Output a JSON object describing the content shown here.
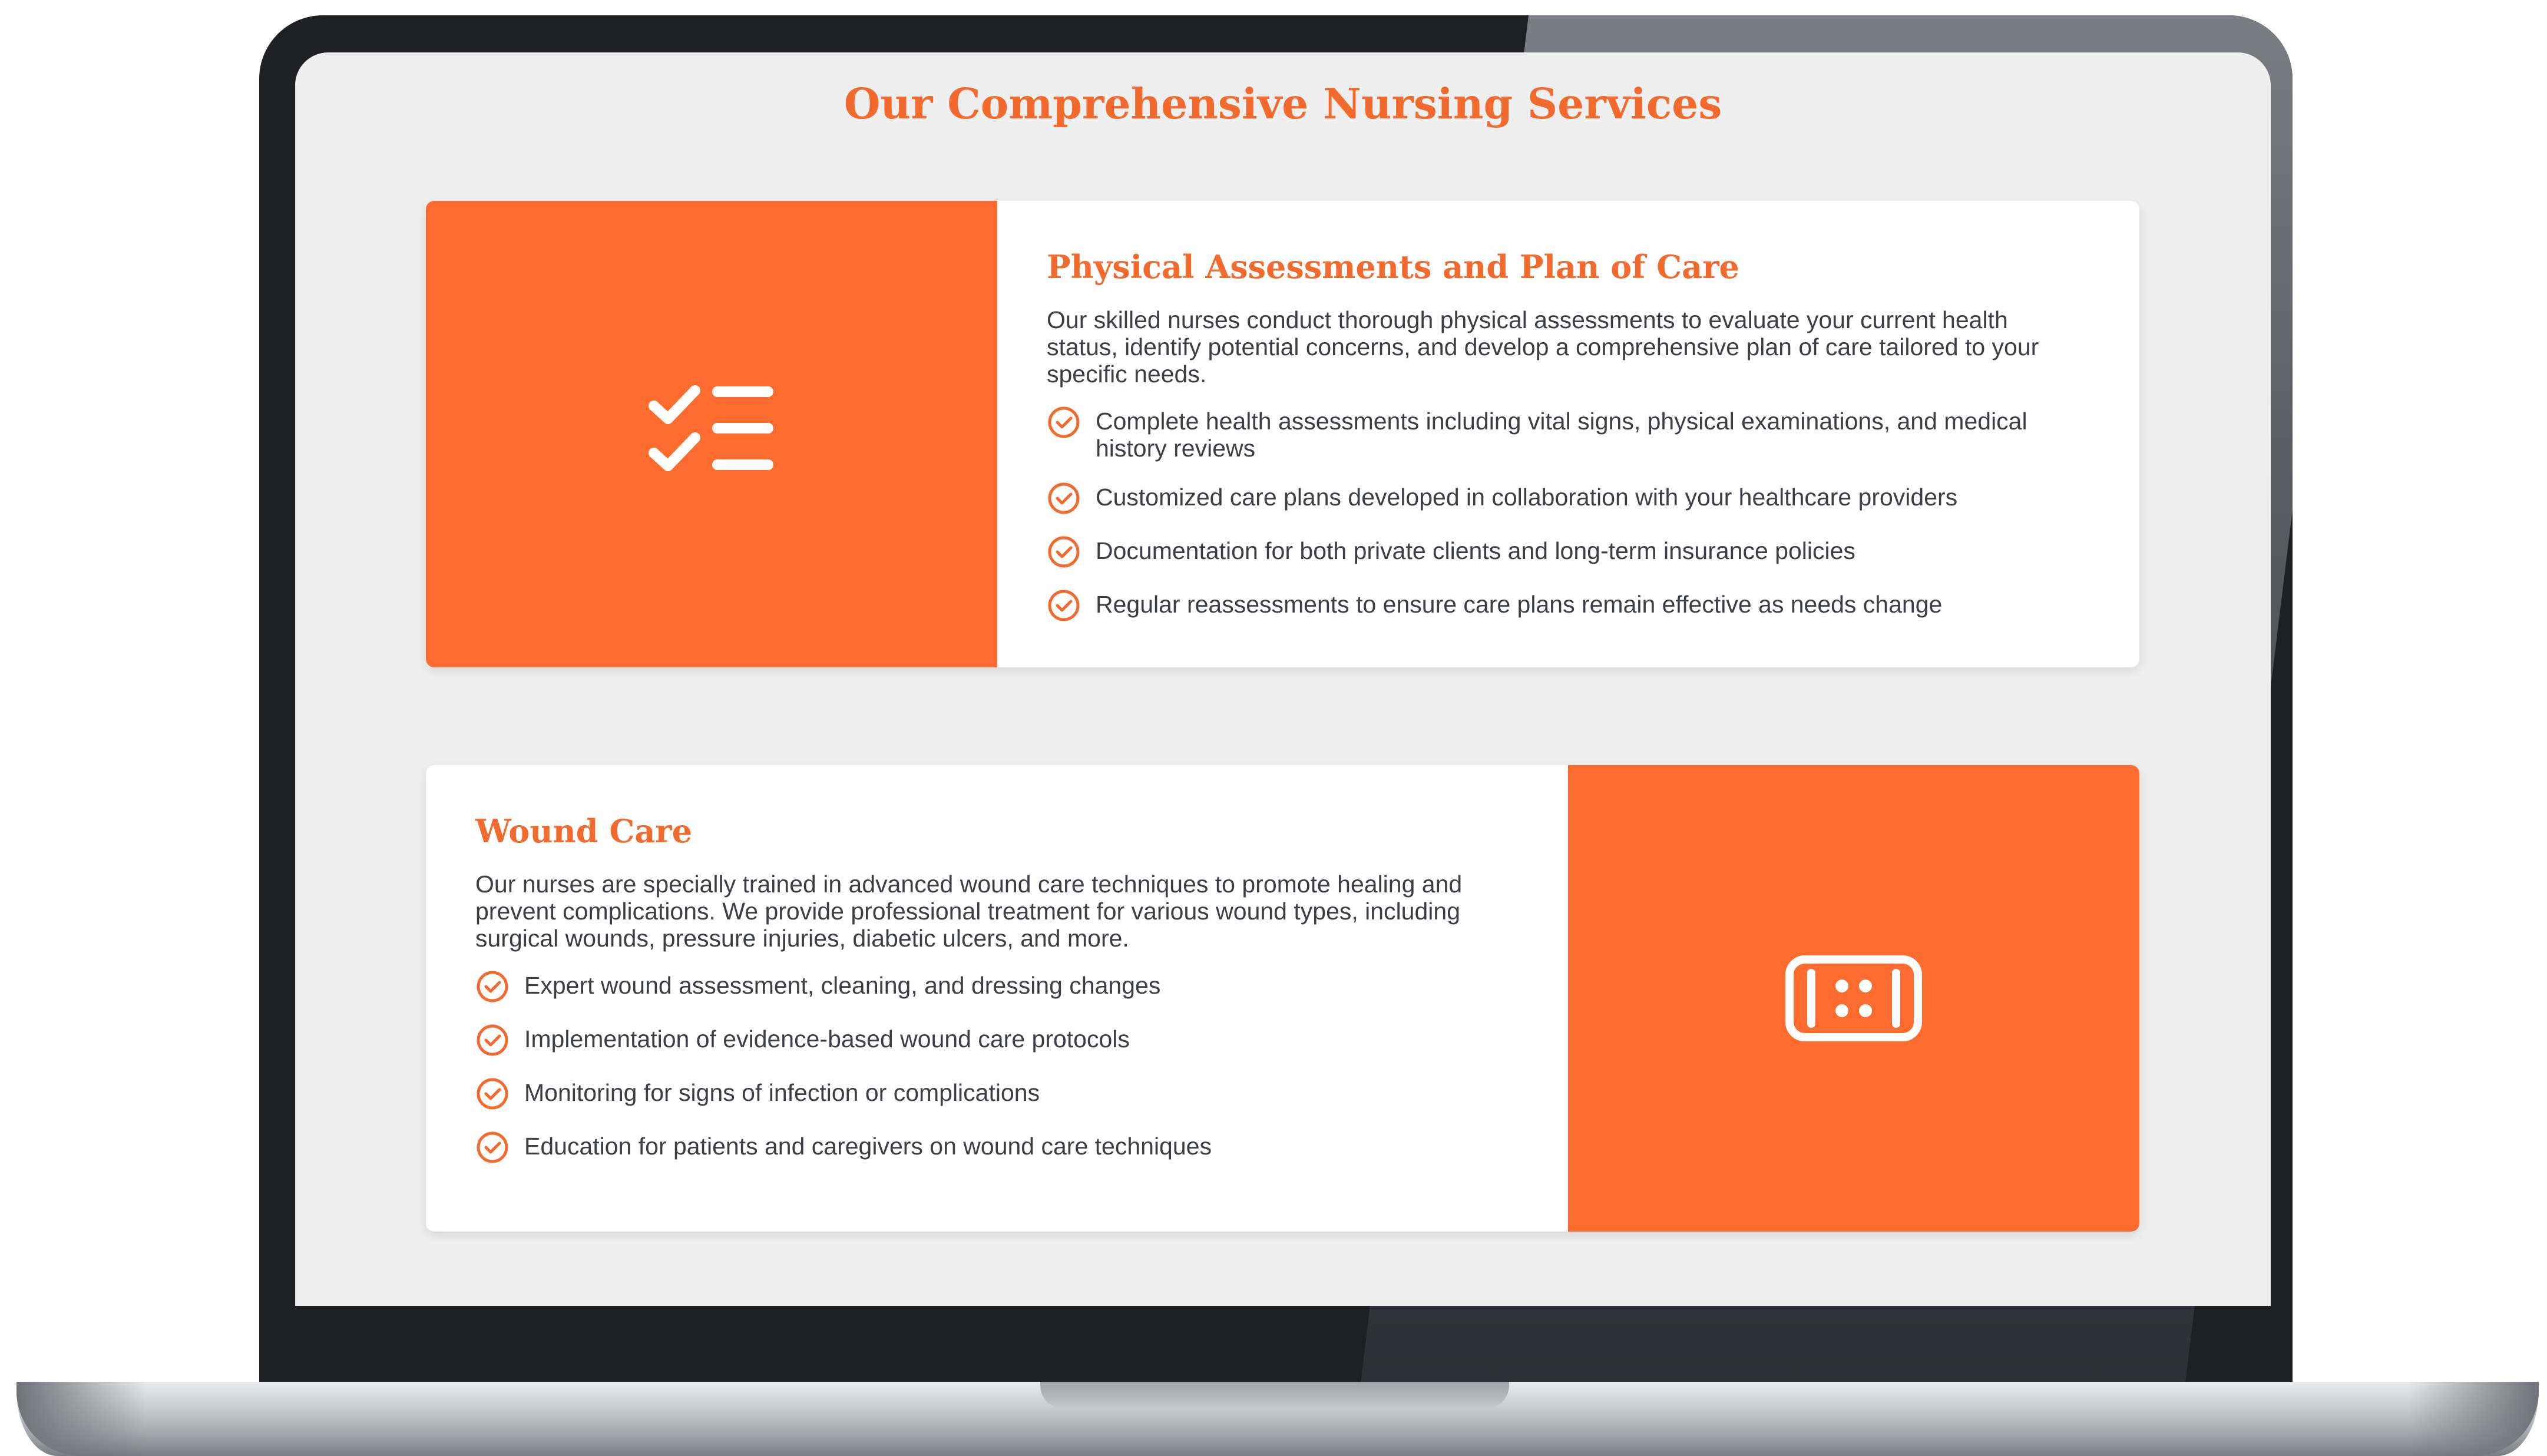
{
  "page": {
    "title": "Our Comprehensive Nursing Services"
  },
  "colors": {
    "accent": "#f26a2e",
    "card_media": "#fd6b2e",
    "body_text": "#3b3f45",
    "screen_bg": "#efefef"
  },
  "services": [
    {
      "icon": "checklist-icon",
      "title": "Physical Assessments and Plan of Care",
      "description": "Our skilled nurses conduct thorough physical assessments to evaluate your current health status, identify potential concerns, and develop a comprehensive plan of care tailored to your specific needs.",
      "features": [
        "Complete health assessments including vital signs, physical examinations, and medical history reviews",
        "Customized care plans developed in collaboration with your healthcare providers",
        "Documentation for both private clients and long-term insurance policies",
        "Regular reassessments to ensure care plans remain effective as needs change"
      ]
    },
    {
      "icon": "bandage-icon",
      "title": "Wound Care",
      "description": "Our nurses are specially trained in advanced wound care techniques to promote healing and prevent complications. We provide professional treatment for various wound types, including surgical wounds, pressure injuries, diabetic ulcers, and more.",
      "features": [
        "Expert wound assessment, cleaning, and dressing changes",
        "Implementation of evidence-based wound care protocols",
        "Monitoring for signs of infection or complications",
        "Education for patients and caregivers on wound care techniques"
      ]
    }
  ]
}
